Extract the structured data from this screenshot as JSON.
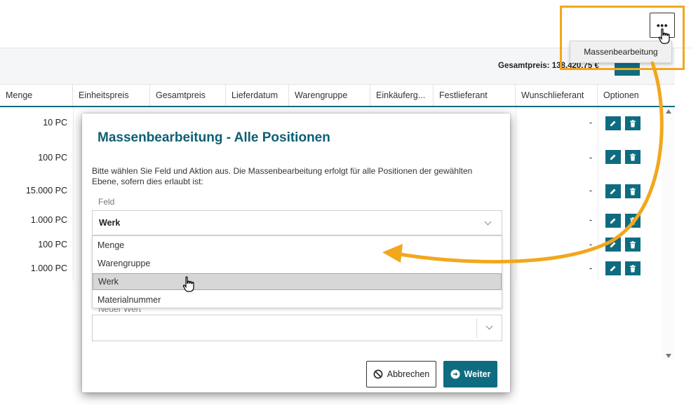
{
  "header": {
    "total_label": "Gesamtpreis: 138.420,75 €",
    "more_button": "•••",
    "more_menu_item": "Massenbearbeitung"
  },
  "table": {
    "columns": [
      "Menge",
      "Einheitspreis",
      "Gesamtpreis",
      "Lieferdatum",
      "Warengruppe",
      "Einkäuferg...",
      "Festlieferant",
      "Wunschlieferant",
      "Optionen"
    ],
    "rows": [
      {
        "menge": "10 PC",
        "wunschlieferant": "-"
      },
      {
        "menge": "100 PC",
        "wunschlieferant": "-"
      },
      {
        "menge": "15.000 PC",
        "wunschlieferant": "-"
      },
      {
        "menge": "1.000 PC",
        "wunschlieferant": "-"
      },
      {
        "menge": "100 PC",
        "wunschlieferant": "-"
      },
      {
        "menge": "1.000 PC",
        "wunschlieferant": "-"
      }
    ]
  },
  "modal": {
    "title": "Massenbearbeitung - Alle Positionen",
    "description": "Bitte wählen Sie Feld und Aktion aus. Die Massenbearbeitung erfolgt für alle Positionen der gewählten Ebene, sofern dies erlaubt ist:",
    "field_label": "Feld",
    "field_value": "Werk",
    "options": [
      "Menge",
      "Warengruppe",
      "Werk",
      "Materialnummer"
    ],
    "selected_option": "Werk",
    "value_label": "Neuer Wert",
    "cancel_label": "Abbrechen",
    "next_label": "Weiter"
  },
  "colors": {
    "accent": "#0e6c80",
    "title": "#0e5f73",
    "highlight": "#f2a71c"
  },
  "icons": [
    "more-dots-icon",
    "pointer-hand-icon",
    "edit-pencil-icon",
    "trash-icon",
    "chevron-down-icon",
    "cancel-circle-icon",
    "arrow-right-circle-icon",
    "scroll-up-icon",
    "scroll-down-icon"
  ]
}
